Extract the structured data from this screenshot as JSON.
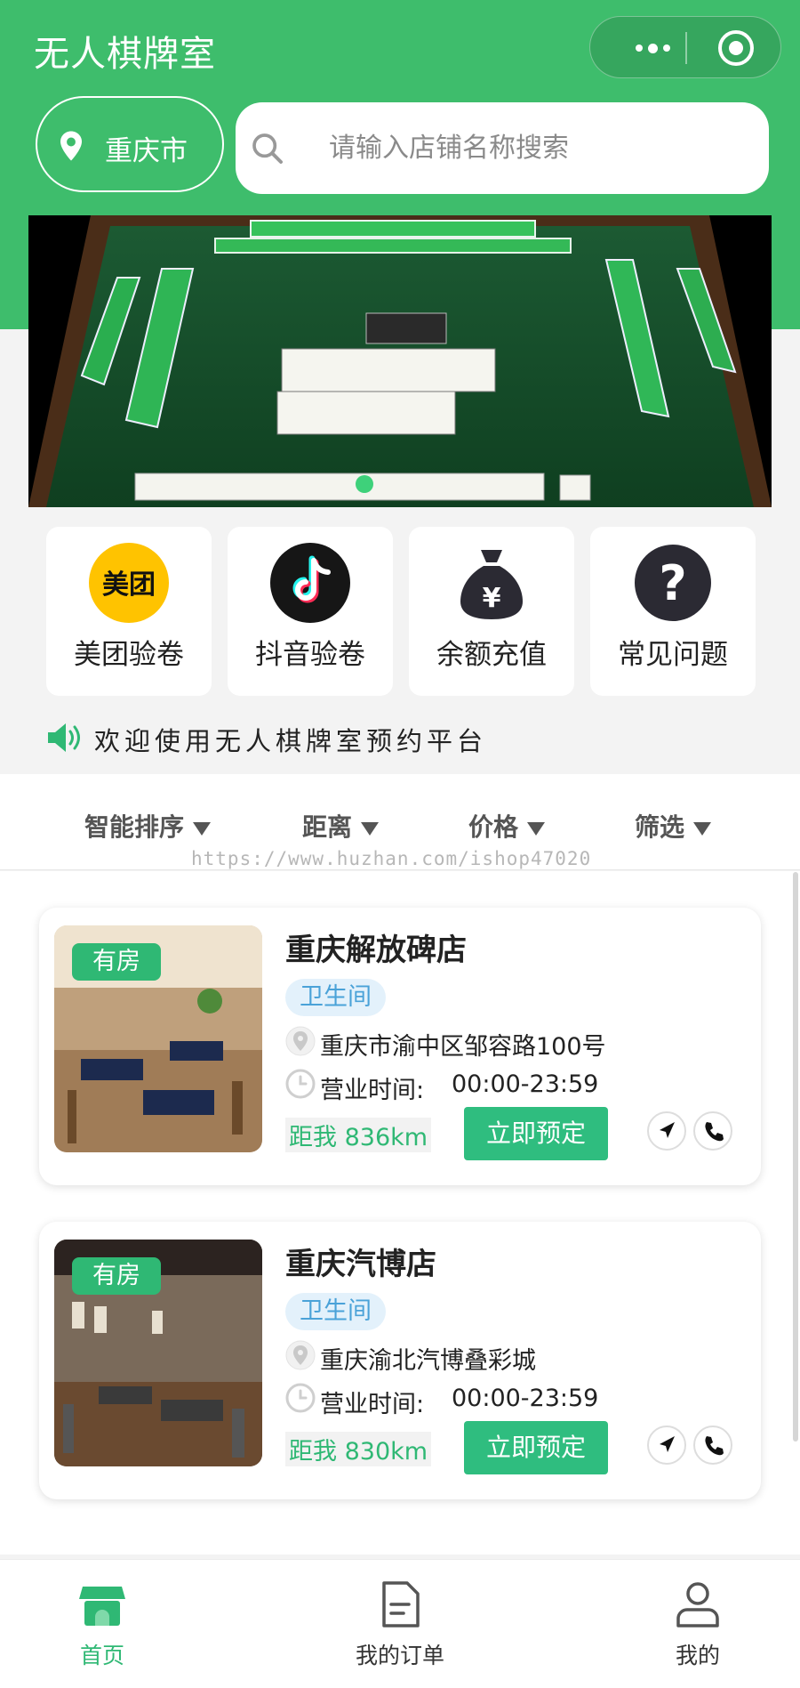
{
  "app": {
    "title": "无人棋牌室"
  },
  "location": {
    "city": "重庆市"
  },
  "search": {
    "placeholder": "请输入店铺名称搜索"
  },
  "quick_links": [
    {
      "label": "美团验卷",
      "icon": "meituan-icon",
      "icon_text": "美团"
    },
    {
      "label": "抖音验卷",
      "icon": "douyin-icon"
    },
    {
      "label": "余额充值",
      "icon": "money-bag-icon",
      "icon_text": "¥"
    },
    {
      "label": "常见问题",
      "icon": "question-icon",
      "icon_text": "?"
    }
  ],
  "notice": {
    "text": "欢迎使用无人棋牌室预约平台"
  },
  "filters": [
    {
      "label": "智能排序"
    },
    {
      "label": "距离"
    },
    {
      "label": "价格"
    },
    {
      "label": "筛选"
    }
  ],
  "watermark": "https://www.huzhan.com/ishop47020",
  "stores": [
    {
      "badge": "有房",
      "name": "重庆解放碑店",
      "tag": "卫生间",
      "address": "重庆市渝中区邹容路100号",
      "hours_label": "营业时间:",
      "hours": "00:00-23:59",
      "distance": "距我 836km",
      "book_label": "立即预定"
    },
    {
      "badge": "有房",
      "name": "重庆汽博店",
      "tag": "卫生间",
      "address": "重庆渝北汽博叠彩城",
      "hours_label": "营业时间:",
      "hours": "00:00-23:59",
      "distance": "距我 830km",
      "book_label": "立即预定"
    }
  ],
  "tabbar": [
    {
      "label": "首页",
      "icon": "home-store-icon",
      "active": true
    },
    {
      "label": "我的订单",
      "icon": "order-document-icon",
      "active": false
    },
    {
      "label": "我的",
      "icon": "user-profile-icon",
      "active": false
    }
  ],
  "colors": {
    "brand_green": "#3ebd6c",
    "accent_green": "#2fb874",
    "tag_blue": "#4aa2d8"
  }
}
